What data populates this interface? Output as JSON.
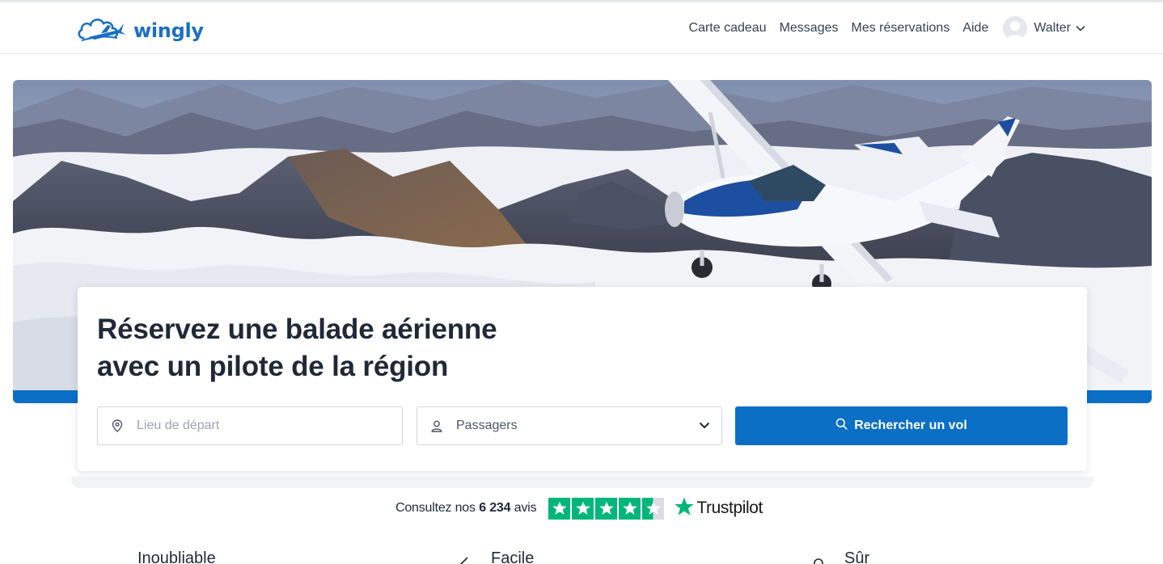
{
  "brand": {
    "name": "wingly",
    "color": "#1a6fc4",
    "logo_icon": "cloud-plane-logo"
  },
  "nav": {
    "links": [
      "Carte cadeau",
      "Messages",
      "Mes réservations",
      "Aide"
    ],
    "user": {
      "name": "Walter",
      "avatar_icon": "user-avatar-icon",
      "menu_icon": "chevron-down-icon"
    }
  },
  "hero": {
    "image": "small airplane flying over mountains above clouds",
    "accent": "#0b6fc6"
  },
  "search": {
    "headline_line1": "Réservez une balade aérienne",
    "headline_line2": "avec un pilote de la région",
    "location_placeholder": "Lieu de départ",
    "location_icon": "map-pin-icon",
    "passengers_label": "Passagers",
    "passengers_icon": "user-icon",
    "button_label": "Rechercher un vol",
    "button_icon": "search-icon",
    "button_color": "#0b6fc6"
  },
  "trustpilot": {
    "prefix": "Consultez nos",
    "count": "6 234",
    "suffix": "avis",
    "rating_stars": 4.5,
    "brand": "Trustpilot",
    "color": "#00b67a"
  },
  "features": [
    "Inoubliable",
    "Facile",
    "Sûr"
  ]
}
